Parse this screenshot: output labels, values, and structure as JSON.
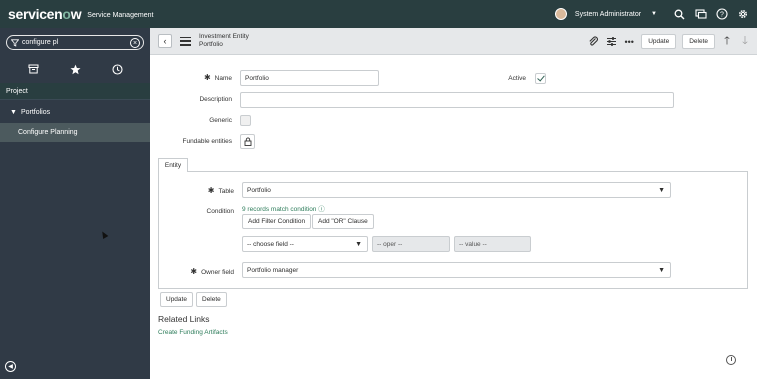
{
  "banner": {
    "logo": "servicenow",
    "app_name": "Service Management",
    "user_name": "System Administrator",
    "icons": [
      "search-icon",
      "chat-icon",
      "help-icon",
      "gear-icon"
    ]
  },
  "nav": {
    "filter_value": "configure pl",
    "section_header": "Project",
    "module": "Portfolios",
    "item": "Configure Planning"
  },
  "header": {
    "title_line1": "Investment Entity",
    "title_line2": "Portfolio",
    "update_label": "Update",
    "delete_label": "Delete"
  },
  "form": {
    "name_label": "Name",
    "name_value": "Portfolio",
    "active_label": "Active",
    "active_checked": true,
    "description_label": "Description",
    "description_value": "",
    "generic_label": "Generic",
    "generic_checked": false,
    "fundable_label": "Fundable entities",
    "section_tab": "Entity",
    "table_label": "Table",
    "table_value": "Portfolio",
    "condition_label": "Condition",
    "records_match": "9 records match condition",
    "add_filter": "Add Filter Condition",
    "add_or": "Add \"OR\" Clause",
    "choose_field": "-- choose field --",
    "oper": "-- oper --",
    "value": "-- value --",
    "owner_label": "Owner field",
    "owner_value": "Portfolio manager",
    "update_label": "Update",
    "delete_label": "Delete"
  },
  "related": {
    "title": "Related Links",
    "link": "Create Funding Artifacts"
  },
  "colors": {
    "banner": "#293e40",
    "nav": "#303a46",
    "nav_selected": "#4c5a5e",
    "link": "#2e7d5b"
  }
}
